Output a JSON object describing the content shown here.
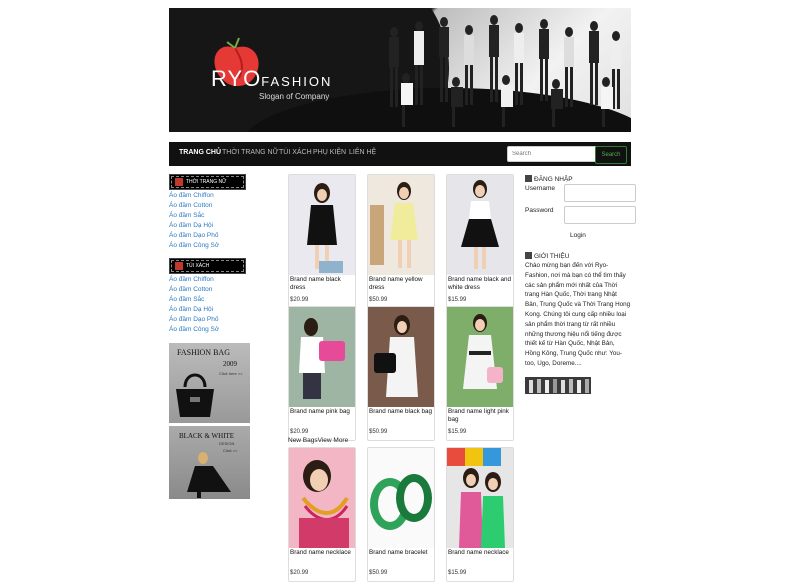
{
  "header": {
    "logo_main": "RYO",
    "logo_sub": "FASHION",
    "slogan": "Slogan of Company"
  },
  "nav": {
    "items": [
      "TRANG CHỦ",
      "THỜI TRANG NỮ",
      "TÚI XÁCH",
      "PHỤ KIỆN",
      "LIÊN HỆ"
    ],
    "search_placeholder": "Search",
    "search_button": "Search"
  },
  "sidebar": {
    "cat1_title": "THỜI TRANG NỮ",
    "cat1_items": [
      "Áo đầm Chiffon",
      "Áo đầm Cotton",
      "Áo đầm Sắc",
      "Áo đầm Dạ Hội",
      "Áo đầm Dạo Phố",
      "Áo đầm Công Sở"
    ],
    "cat2_title": "TÚI XÁCH",
    "cat2_items": [
      "Áo đầm Chiffon",
      "Áo đầm Cotton",
      "Áo đầm Sắc",
      "Áo đầm Dạ Hội",
      "Áo đầm Dạo Phố",
      "Áo đầm Công Sở"
    ],
    "ad1": {
      "title": "FASHION BAG",
      "year": "2009",
      "link": "Click here >>"
    },
    "ad2": {
      "title": "BLACK & WHITE",
      "sub": "DESIGN",
      "link": "Click >>"
    }
  },
  "products": [
    {
      "name": "Brand name black dress",
      "price": "$20.99"
    },
    {
      "name": "Brand name yellow dress",
      "price": "$50.99"
    },
    {
      "name": "Brand name black and white dress",
      "price": "$15.99"
    },
    {
      "name": "Brand name pink bag",
      "price": "$20.99"
    },
    {
      "name": "Brand name black bag",
      "price": "$50.99"
    },
    {
      "name": "Brand name light pink bag",
      "price": "$15.99"
    },
    {
      "name": "Brand name necklace",
      "price": "$20.99"
    },
    {
      "name": "Brand name bracelet",
      "price": "$50.99"
    },
    {
      "name": "Brand name necklace",
      "price": "$15.99"
    }
  ],
  "new_bags": "New BagsView More",
  "login": {
    "title": "ĐĂNG NHẬP",
    "username_label": "Username",
    "password_label": "Password",
    "button": "Login"
  },
  "intro": {
    "title": "GIỚI THIỆU",
    "text": "Chào mừng bạn đến với Ryo-Fashion, nơi mà bạn có thể tìm thấy các sản phẩm mới nhất của Thời trang Hàn Quốc, Thời trang Nhật Bản, Trung Quốc và Thời Trang Hong Kong. Chúng tôi cung cấp nhiều loại sản phẩm thời trang từ rất nhiều những thương hiệu nổi tiếng được thiết kế từ Hàn Quốc, Nhật Bản, Hồng Kông, Trung Quốc như: You-too, Ugo, Doreme...."
  },
  "colors": {
    "link": "#2a7ac0",
    "nav_bg": "#111111",
    "accent_red": "#e53935",
    "search_green": "#4caf50"
  }
}
